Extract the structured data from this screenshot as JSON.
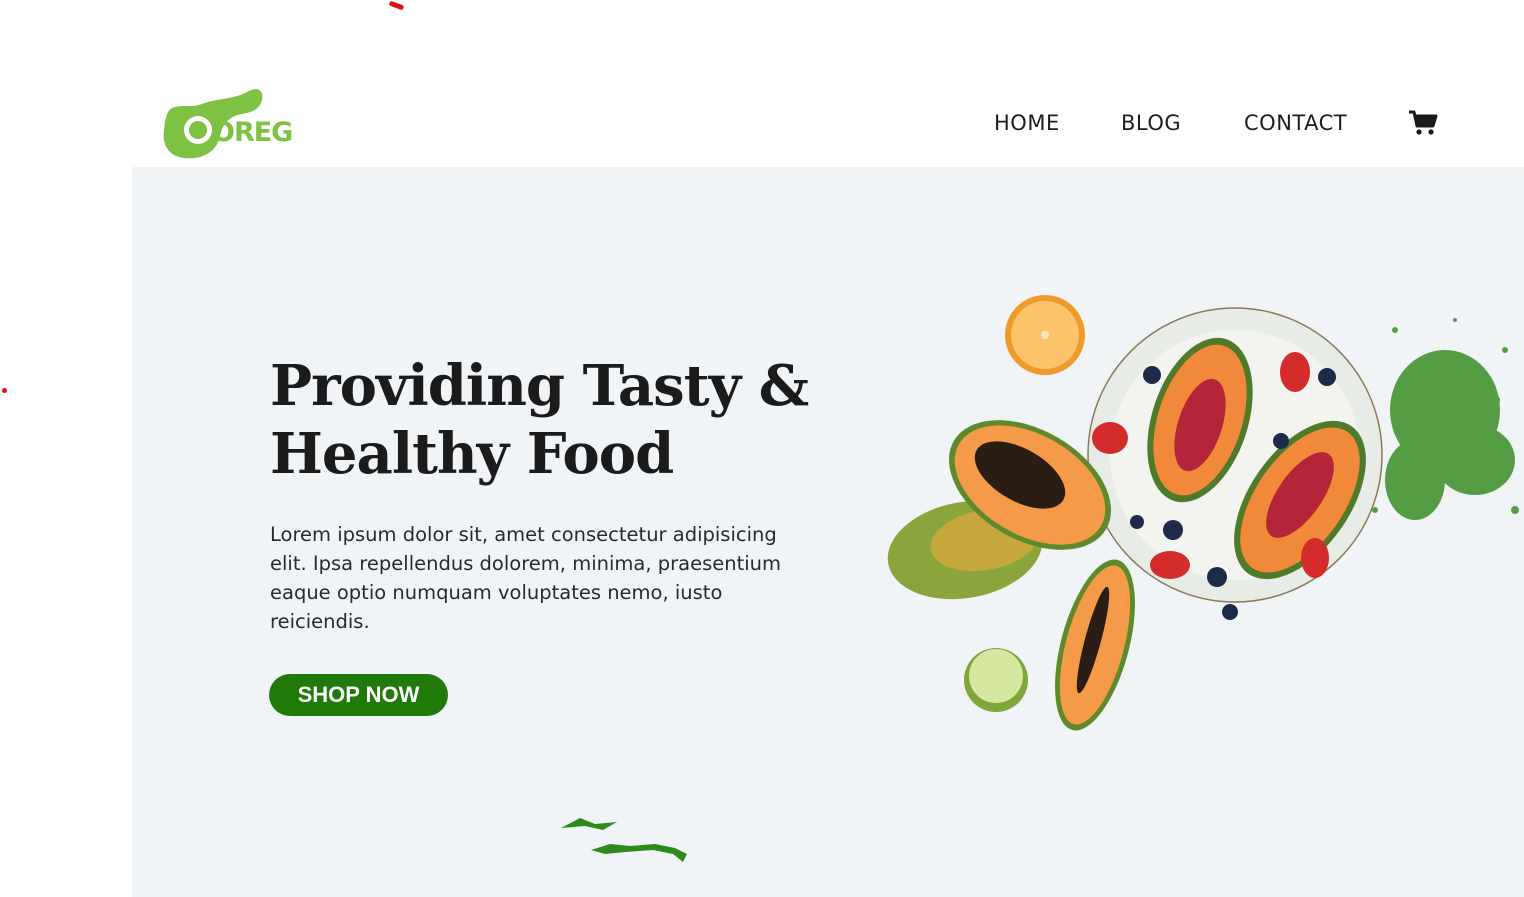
{
  "brand": {
    "logo_text": "OREG",
    "logo_color": "#7dc242"
  },
  "nav": {
    "items": [
      "HOME",
      "BLOG",
      "CONTACT"
    ],
    "cart_icon": "cart-icon"
  },
  "hero": {
    "title_line1": "Providing Tasty &",
    "title_line2": "Healthy Food",
    "description": "Lorem ipsum dolor sit, amet consectetur adipisicing elit. Ipsa repellendus dolorem, minima, praesentium eaque optio numquam voluptates nemo, iusto reiciendis.",
    "cta_label": "SHOP NOW",
    "cta_color": "#1f7a0a",
    "background": "#f1f4f7"
  }
}
